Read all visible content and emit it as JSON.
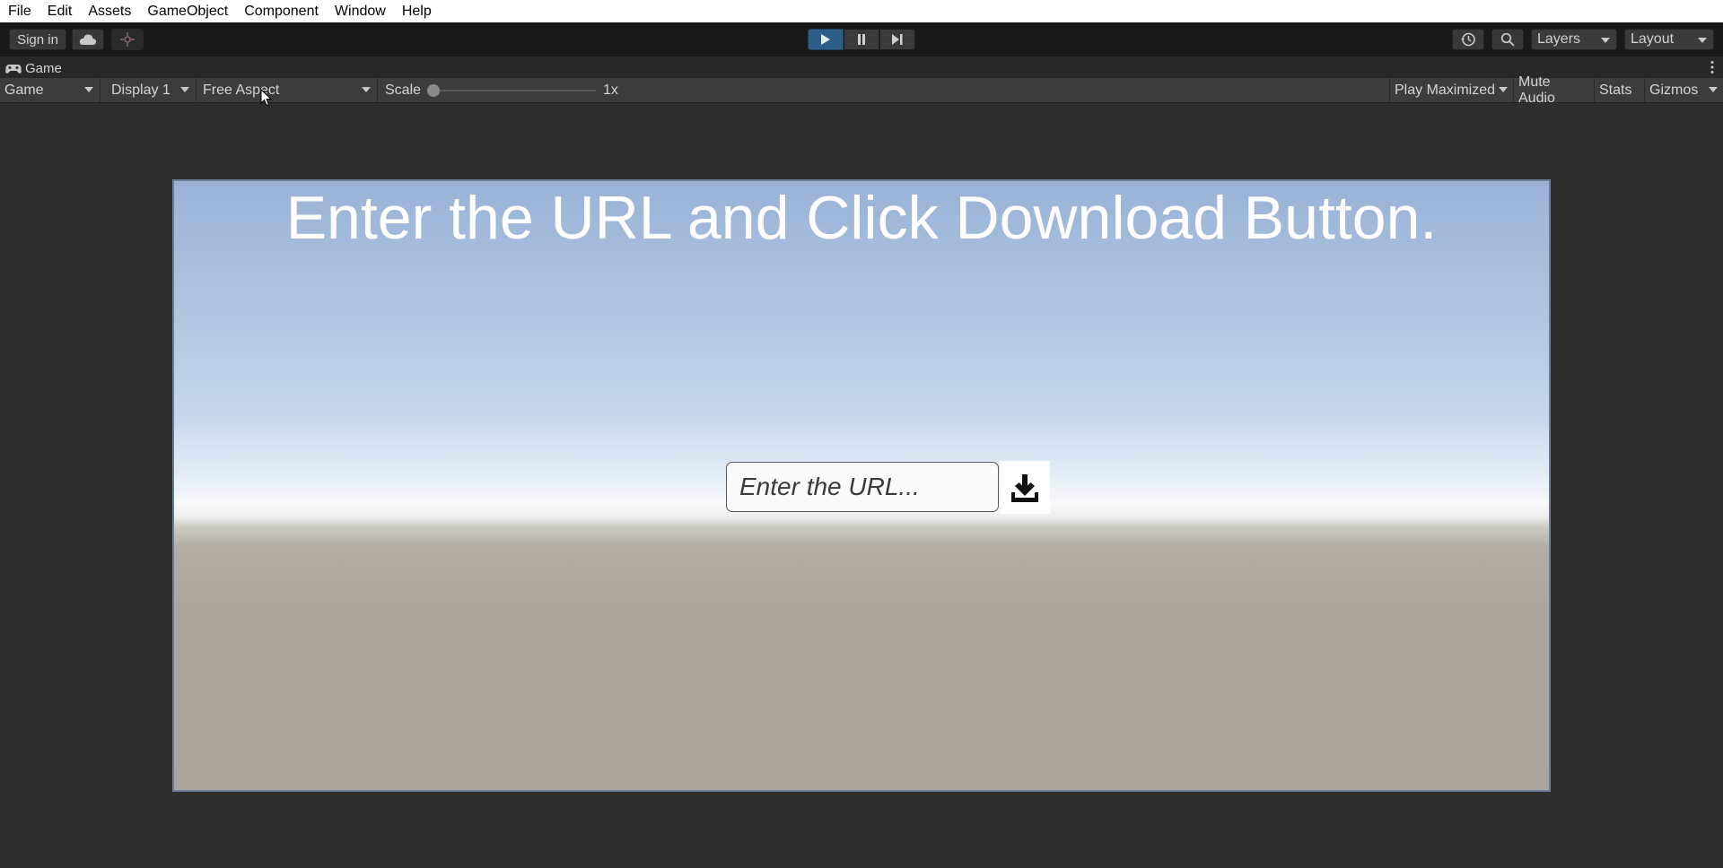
{
  "menubar": {
    "items": [
      "File",
      "Edit",
      "Assets",
      "GameObject",
      "Component",
      "Window",
      "Help"
    ]
  },
  "toolbar": {
    "sign_in_label": "Sign in",
    "layers_label": "Layers",
    "layout_label": "Layout",
    "play_active": true
  },
  "tab": {
    "label": "Game"
  },
  "gamebar": {
    "view_select": "Game",
    "display_select": "Display 1",
    "aspect_select": "Free Aspect",
    "scale_label": "Scale",
    "scale_value": "1x",
    "play_maximized_label": "Play Maximized",
    "mute_audio_label": "Mute Audio",
    "stats_label": "Stats",
    "gizmos_label": "Gizmos"
  },
  "game": {
    "headline": "Enter the URL and Click Download Button.",
    "url_placeholder": "Enter the URL...",
    "url_value": ""
  },
  "colors": {
    "toolbar_bg": "#191919",
    "play_accent": "#2c5d87",
    "gamebar_bg": "#3c3c3c",
    "sky_top": "#99b2d6",
    "ground": "#a9a59d"
  }
}
